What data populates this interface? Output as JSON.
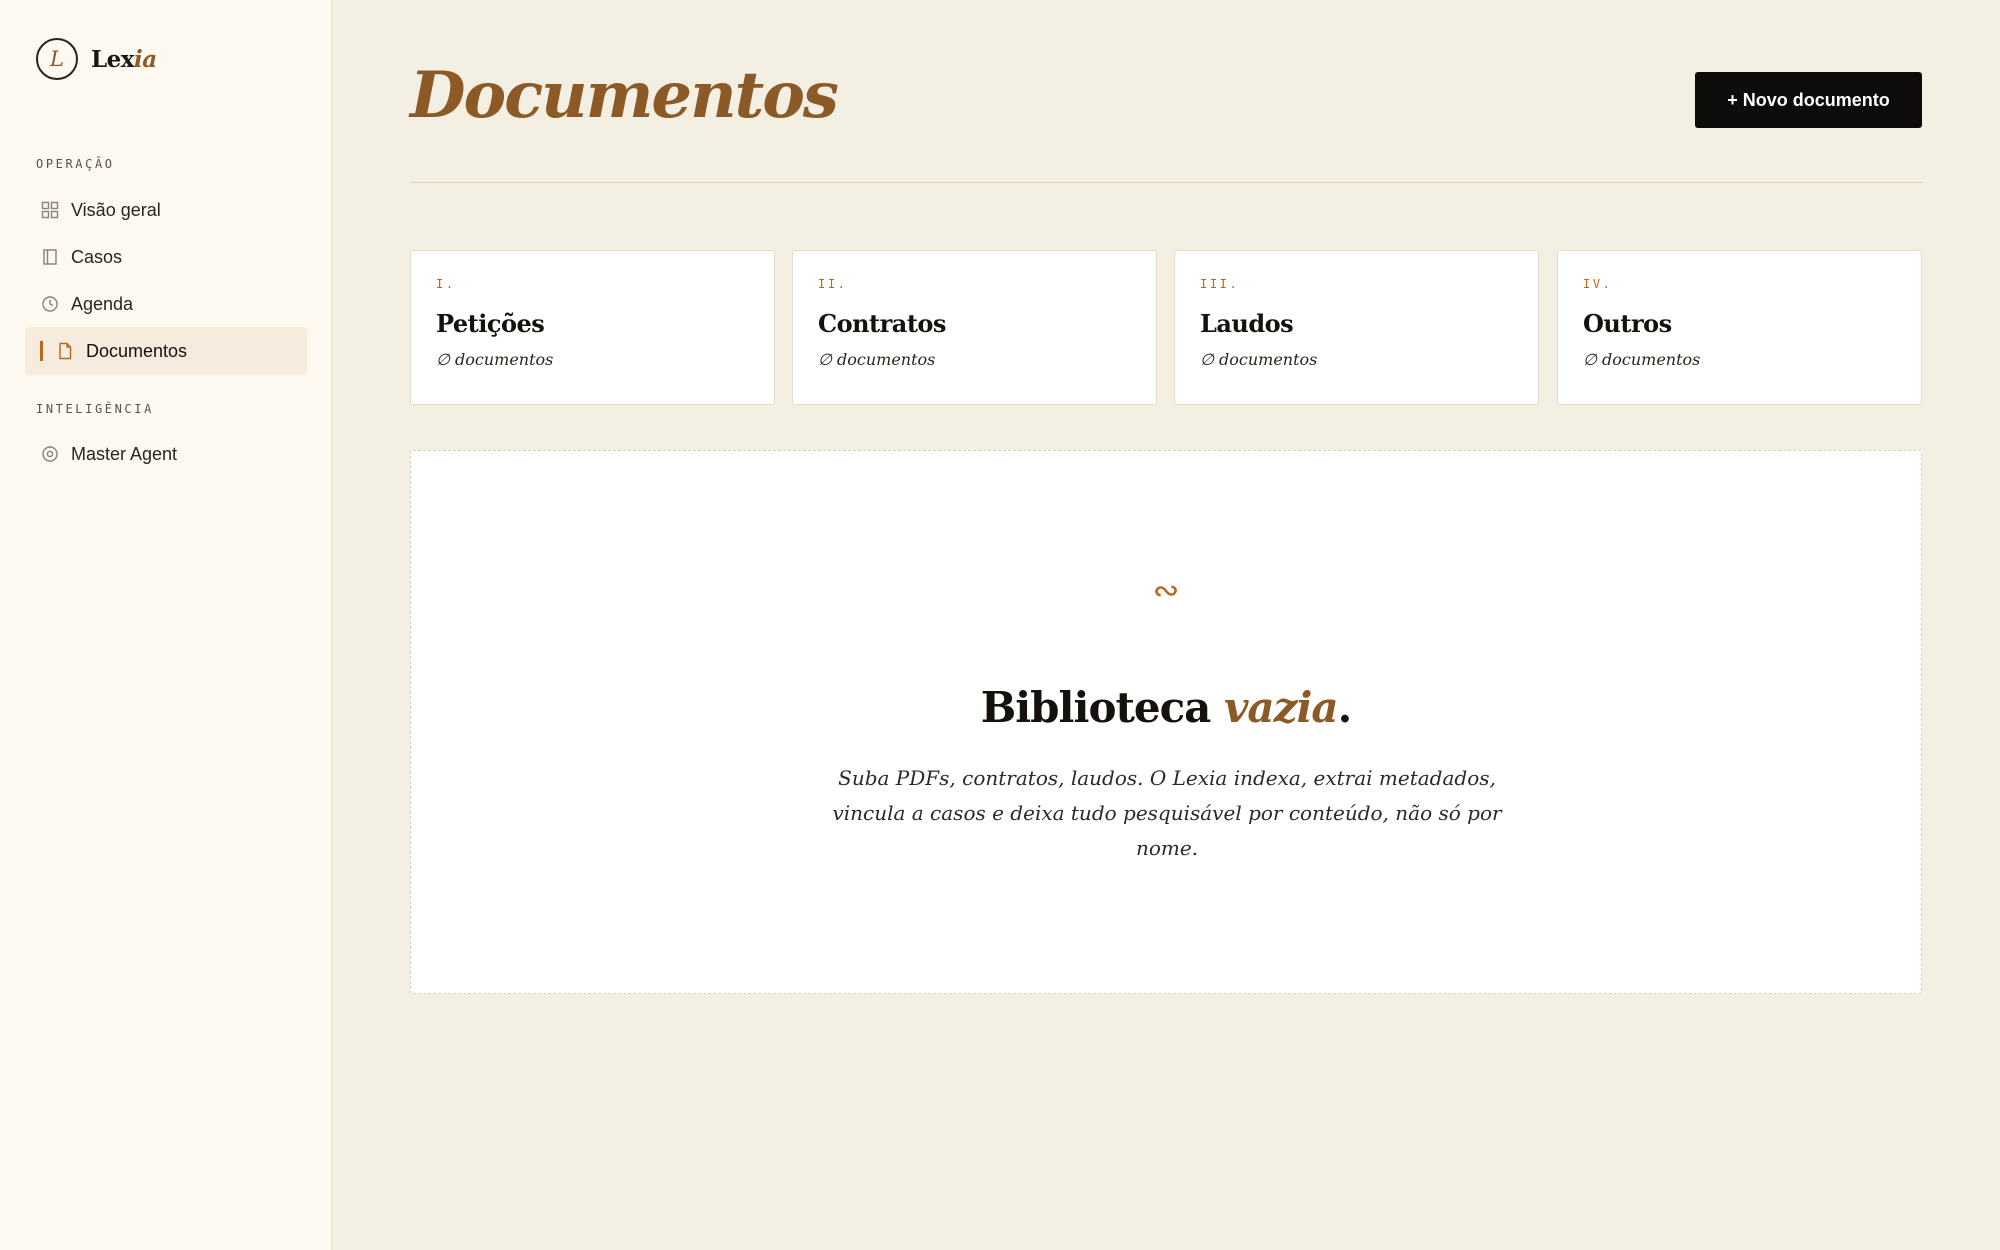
{
  "brand": {
    "mark": "L",
    "name": "Lex",
    "name_accent": "ia"
  },
  "sidebar": {
    "sections": [
      {
        "label": "OPERAÇÃO",
        "items": [
          {
            "label": "Visão geral",
            "icon": "grid-icon"
          },
          {
            "label": "Casos",
            "icon": "book-icon"
          },
          {
            "label": "Agenda",
            "icon": "clock-icon"
          },
          {
            "label": "Documentos",
            "icon": "file-icon",
            "active": true
          }
        ]
      },
      {
        "label": "INTELIGÊNCIA",
        "items": [
          {
            "label": "Master Agent",
            "icon": "target-icon"
          }
        ]
      }
    ]
  },
  "header": {
    "title": "Documentos",
    "new_button": "+ Novo documento"
  },
  "categories": [
    {
      "numeral": "I.",
      "title": "Petições",
      "count": "∅ documentos"
    },
    {
      "numeral": "II.",
      "title": "Contratos",
      "count": "∅ documentos"
    },
    {
      "numeral": "III.",
      "title": "Laudos",
      "count": "∅ documentos"
    },
    {
      "numeral": "IV.",
      "title": "Outros",
      "count": "∅ documentos"
    }
  ],
  "empty_state": {
    "glyph": "∾",
    "title": "Biblioteca ",
    "title_accent": "vazia",
    "title_end": ".",
    "description": "Suba PDFs, contratos, laudos. O Lexia indexa, extrai metadados, vincula a casos e deixa tudo pesquisável por conteúdo, não só por nome."
  },
  "colors": {
    "accent": "#8b5a26",
    "accent_orange": "#b8671f",
    "background": "#f4efe3",
    "sidebar_bg": "#fdf9f0",
    "button_bg": "#0d0c0b"
  }
}
